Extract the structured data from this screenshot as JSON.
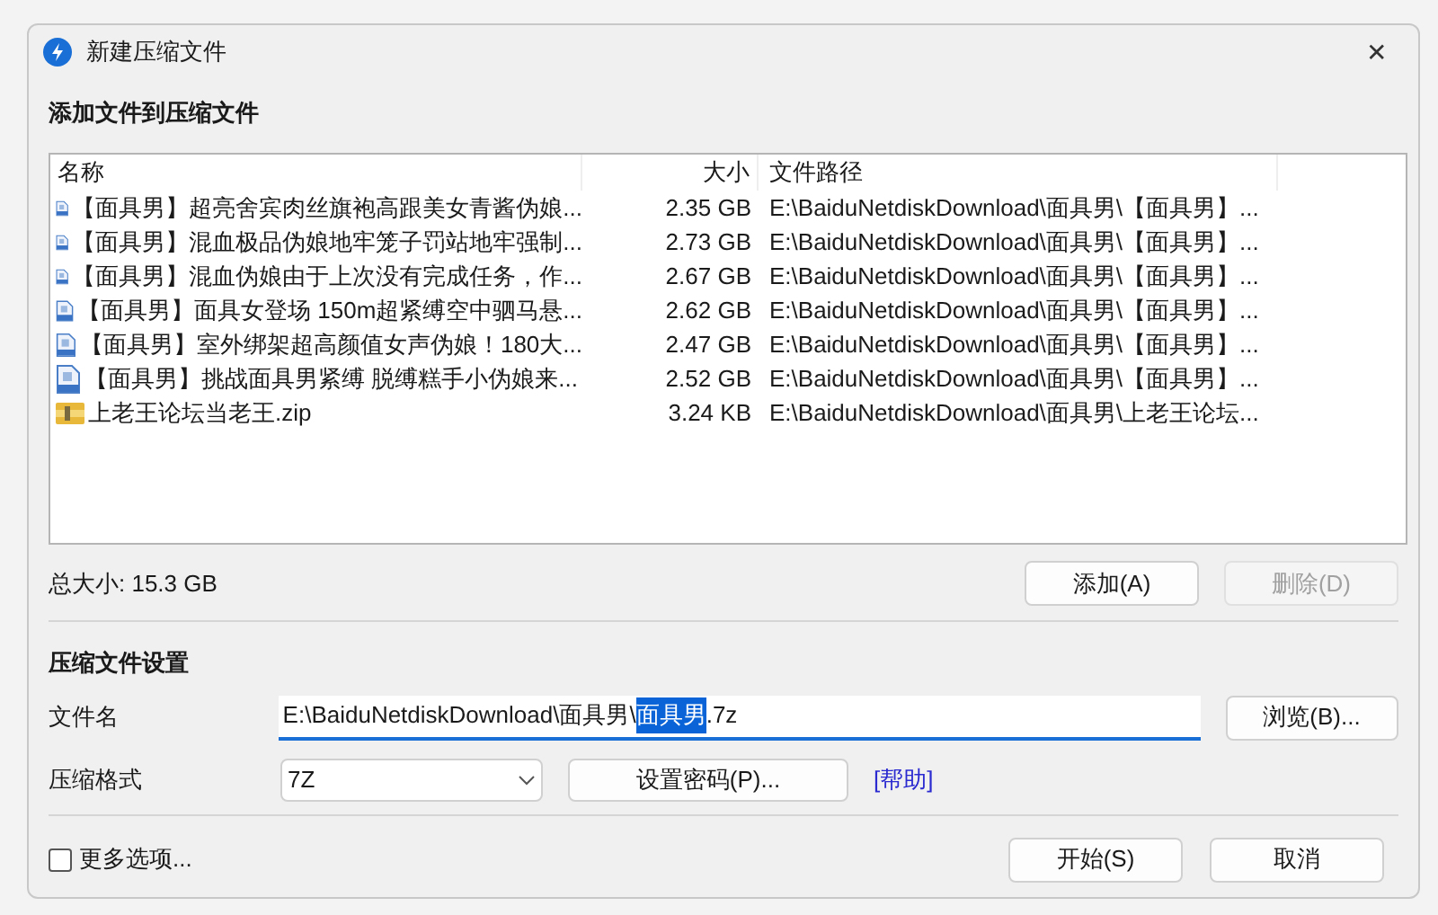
{
  "window": {
    "title": "新建压缩文件",
    "close": "✕"
  },
  "files_section": {
    "title": "添加文件到压缩文件",
    "columns": [
      "名称",
      "大小",
      "文件路径"
    ],
    "rows": [
      {
        "kind": "document",
        "name": "【面具男】超亮舍宾肉丝旗袍高跟美女青酱伪娘...",
        "size": "2.35 GB",
        "path": "E:\\BaiduNetdiskDownload\\面具男\\【面具男】..."
      },
      {
        "kind": "document",
        "name": "【面具男】混血极品伪娘地牢笼子罚站地牢强制...",
        "size": "2.73 GB",
        "path": "E:\\BaiduNetdiskDownload\\面具男\\【面具男】..."
      },
      {
        "kind": "document",
        "name": "【面具男】混血伪娘由于上次没有完成任务，作...",
        "size": "2.67 GB",
        "path": "E:\\BaiduNetdiskDownload\\面具男\\【面具男】..."
      },
      {
        "kind": "document",
        "name": "【面具男】面具女登场 150m超紧缚空中驷马悬...",
        "size": "2.62 GB",
        "path": "E:\\BaiduNetdiskDownload\\面具男\\【面具男】..."
      },
      {
        "kind": "document",
        "name": "【面具男】室外绑架超高颜值女声伪娘！180大...",
        "size": "2.47 GB",
        "path": "E:\\BaiduNetdiskDownload\\面具男\\【面具男】..."
      },
      {
        "kind": "document",
        "name": "【面具男】挑战面具男紧缚 脱缚糕手小伪娘来...",
        "size": "2.52 GB",
        "path": "E:\\BaiduNetdiskDownload\\面具男\\【面具男】..."
      },
      {
        "kind": "archive",
        "name": "上老王论坛当老王.zip",
        "size": "3.24 KB",
        "path": "E:\\BaiduNetdiskDownload\\面具男\\上老王论坛..."
      }
    ],
    "total": "总大小: 15.3 GB",
    "buttons": [
      {
        "label": "添加(A)",
        "disabled": false
      },
      {
        "label": "删除(D)",
        "disabled": true
      }
    ]
  },
  "settings": {
    "title": "压缩文件设置",
    "filename_label": "文件名",
    "filename_parts": [
      {
        "text": "E:\\BaiduNetdiskDownload\\面具男\\",
        "selected": false
      },
      {
        "text": "面具男",
        "selected": true
      },
      {
        "text": ".7z",
        "selected": false
      }
    ],
    "browse": "浏览(B)...",
    "format_label": "压缩格式",
    "format": "7Z",
    "password": "设置密码(P)...",
    "help": "[帮助]"
  },
  "footer": {
    "more_options": {
      "label": "更多选项...",
      "checked": false
    },
    "buttons": [
      "开始(S)",
      "取消"
    ]
  }
}
